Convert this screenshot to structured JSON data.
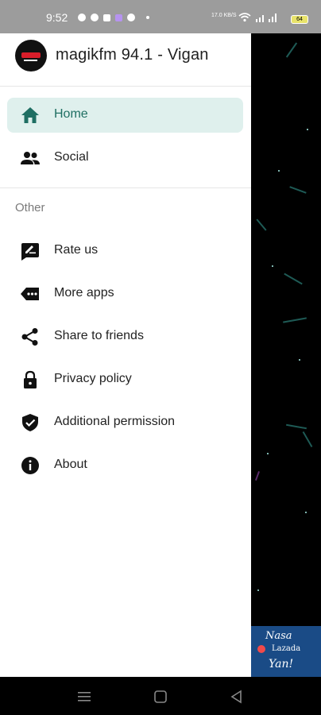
{
  "status_bar": {
    "time": "9:52",
    "network_speed": "17.0 KB/S",
    "battery": "64"
  },
  "drawer": {
    "app_title": "magikfm 94.1 - Vigan",
    "main_items": [
      {
        "label": "Home",
        "icon": "home-icon",
        "active": true
      },
      {
        "label": "Social",
        "icon": "people-icon",
        "active": false
      }
    ],
    "section_title": "Other",
    "other_items": [
      {
        "label": "Rate us",
        "icon": "rate-icon"
      },
      {
        "label": "More apps",
        "icon": "more-apps-icon"
      },
      {
        "label": "Share to friends",
        "icon": "share-icon"
      },
      {
        "label": "Privacy policy",
        "icon": "lock-icon"
      },
      {
        "label": "Additional permission",
        "icon": "shield-check-icon"
      },
      {
        "label": "About",
        "icon": "info-icon"
      }
    ]
  },
  "ad": {
    "line1": "Nasa",
    "line2": "Lazada",
    "line3": "Yan!"
  },
  "colors": {
    "accent": "#1f6f63",
    "active_bg": "#dff0ed",
    "status_bar": "#9c9c9c"
  }
}
